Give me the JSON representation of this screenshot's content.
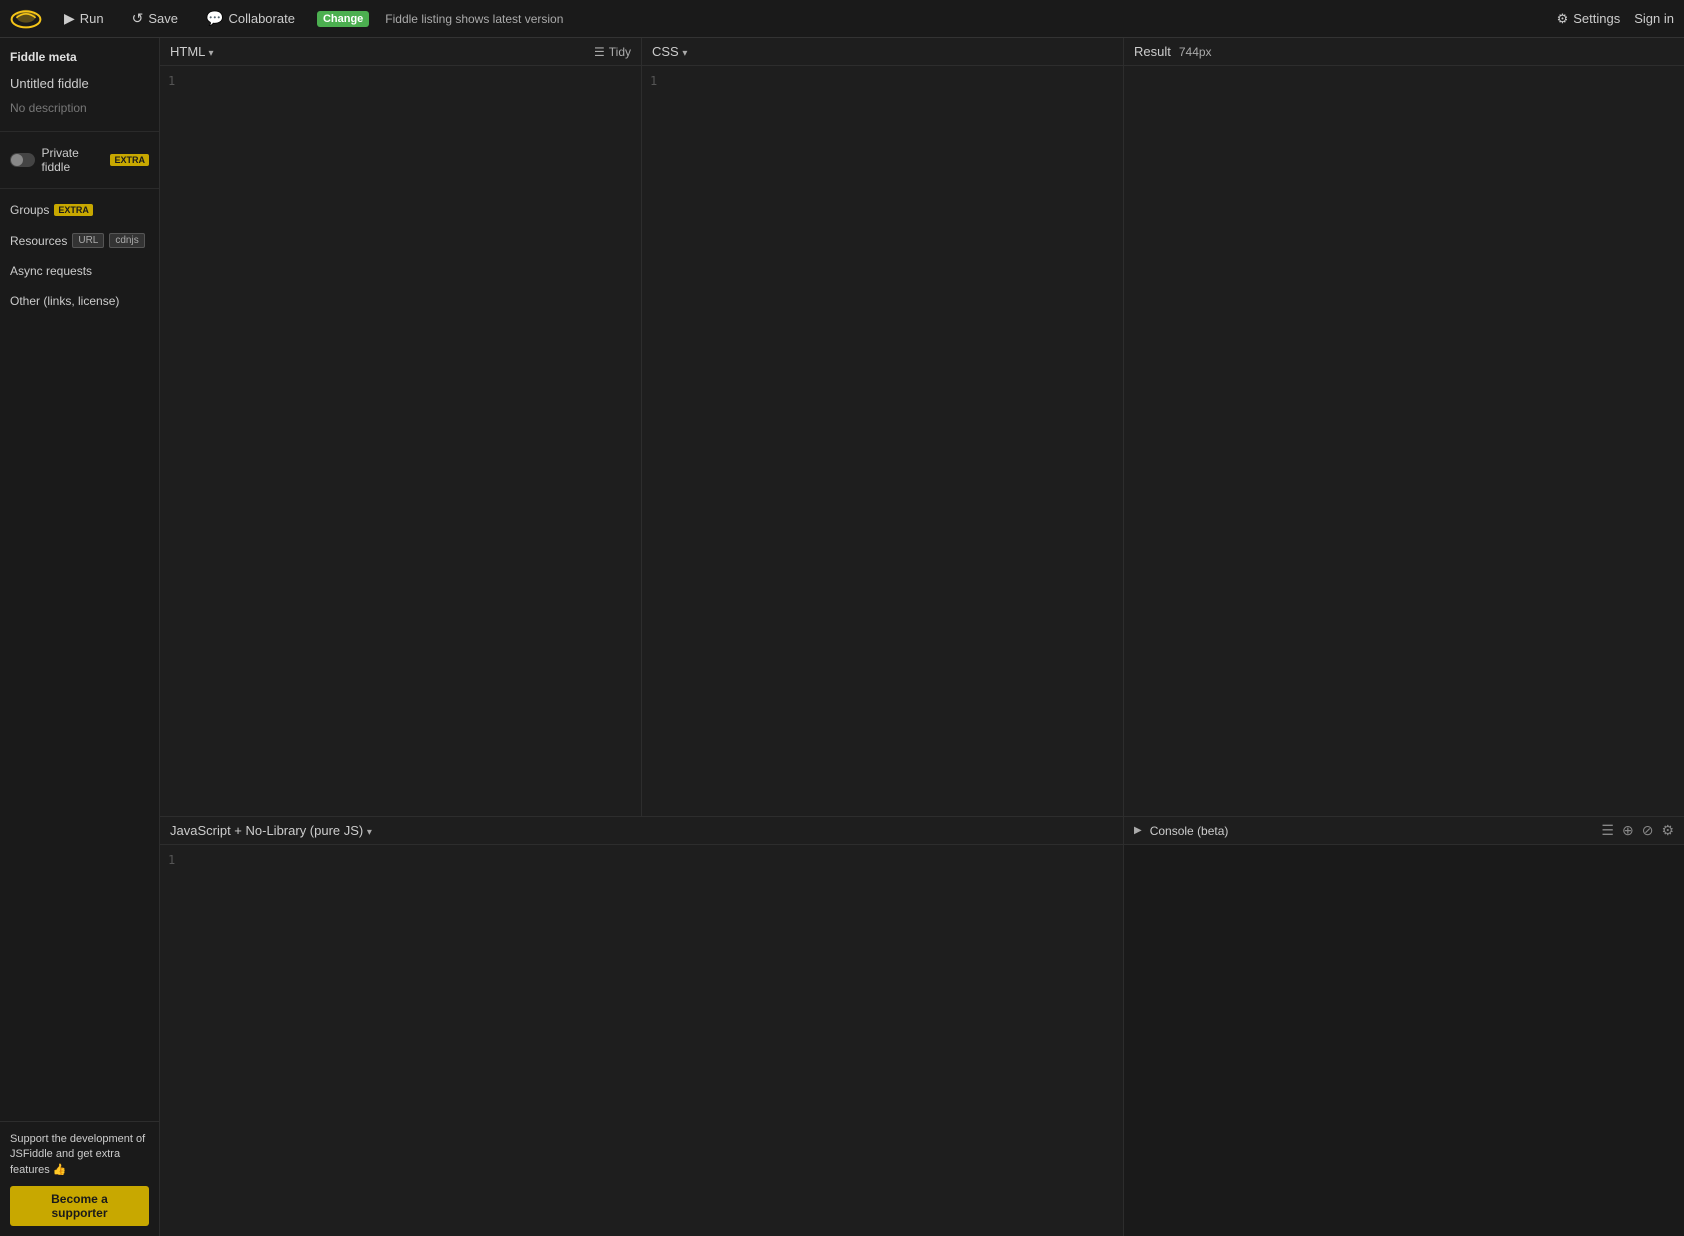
{
  "topnav": {
    "run_label": "Run",
    "save_label": "Save",
    "collaborate_label": "Collaborate",
    "change_badge": "Change",
    "change_description": "Fiddle listing shows latest version",
    "settings_label": "Settings",
    "signin_label": "Sign in"
  },
  "sidebar": {
    "meta_title": "Fiddle meta",
    "fiddle_title": "Untitled fiddle",
    "description": "No description",
    "private_label": "Private fiddle",
    "extra_badge": "EXTRA",
    "groups_label": "Groups",
    "resources_label": "Resources",
    "url_badge": "URL",
    "cdnjs_badge": "cdnjs",
    "async_label": "Async requests",
    "other_label": "Other (links, license)",
    "support_text": "Support the development of JSFiddle and get extra features 👍",
    "supporter_btn": "Become a supporter"
  },
  "html_panel": {
    "title": "HTML",
    "tidy_label": "Tidy",
    "line_number": "1"
  },
  "css_panel": {
    "title": "CSS",
    "dropdown_label": "CSS ▾",
    "line_number": "1"
  },
  "js_panel": {
    "title": "JavaScript + No-Library (pure JS)",
    "dropdown_label": "▾",
    "line_number": "1"
  },
  "result_panel": {
    "title": "Result",
    "size": "744px"
  },
  "console_panel": {
    "title": "Console (beta)"
  }
}
